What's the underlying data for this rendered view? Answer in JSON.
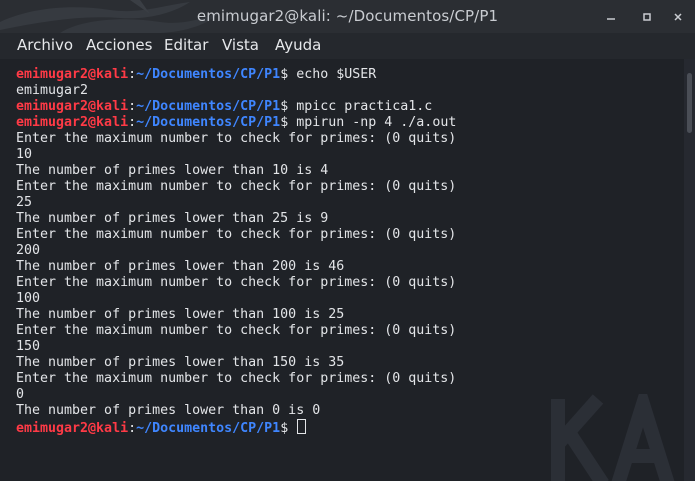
{
  "window": {
    "title": "emimugar2@kali: ~/Documentos/CP/P1"
  },
  "menu": {
    "items": [
      {
        "label": "Archivo"
      },
      {
        "label": "Acciones"
      },
      {
        "label": "Editar"
      },
      {
        "label": "Vista"
      },
      {
        "label": "Ayuda"
      }
    ]
  },
  "prompt": {
    "user": "emimugar2@kali",
    "colon": ":",
    "path": "~/Documentos/CP/P1",
    "dollar": "$"
  },
  "terminal": {
    "lines": [
      {
        "type": "prompt",
        "cmd": " echo $USER"
      },
      {
        "type": "out",
        "text": "emimugar2"
      },
      {
        "type": "prompt",
        "cmd": " mpicc practica1.c"
      },
      {
        "type": "prompt",
        "cmd": " mpirun -np 4 ./a.out"
      },
      {
        "type": "out",
        "text": "Enter the maximum number to check for primes: (0 quits)"
      },
      {
        "type": "out",
        "text": "10"
      },
      {
        "type": "out",
        "text": "The number of primes lower than 10 is 4"
      },
      {
        "type": "out",
        "text": "Enter the maximum number to check for primes: (0 quits)"
      },
      {
        "type": "out",
        "text": "25"
      },
      {
        "type": "out",
        "text": "The number of primes lower than 25 is 9"
      },
      {
        "type": "out",
        "text": "Enter the maximum number to check for primes: (0 quits)"
      },
      {
        "type": "out",
        "text": "200"
      },
      {
        "type": "out",
        "text": "The number of primes lower than 200 is 46"
      },
      {
        "type": "out",
        "text": "Enter the maximum number to check for primes: (0 quits)"
      },
      {
        "type": "out",
        "text": "100"
      },
      {
        "type": "out",
        "text": "The number of primes lower than 100 is 25"
      },
      {
        "type": "out",
        "text": "Enter the maximum number to check for primes: (0 quits)"
      },
      {
        "type": "out",
        "text": "150"
      },
      {
        "type": "out",
        "text": "The number of primes lower than 150 is 35"
      },
      {
        "type": "out",
        "text": "Enter the maximum number to check for primes: (0 quits)"
      },
      {
        "type": "out",
        "text": "0"
      },
      {
        "type": "out",
        "text": "The number of primes lower than 0 is 0"
      },
      {
        "type": "prompt",
        "cmd": " ",
        "cursor": true
      }
    ]
  },
  "colors": {
    "prompt_user": "#ff3a46",
    "prompt_path": "#3f86ff",
    "text": "#e3e5e8",
    "background": "#1f2227"
  },
  "icons": {
    "titlebar_logo": "kali-dragon-icon",
    "watermark": "kali-watermark",
    "minimize": "minimize-icon",
    "maximize": "maximize-icon",
    "close": "close-icon"
  }
}
